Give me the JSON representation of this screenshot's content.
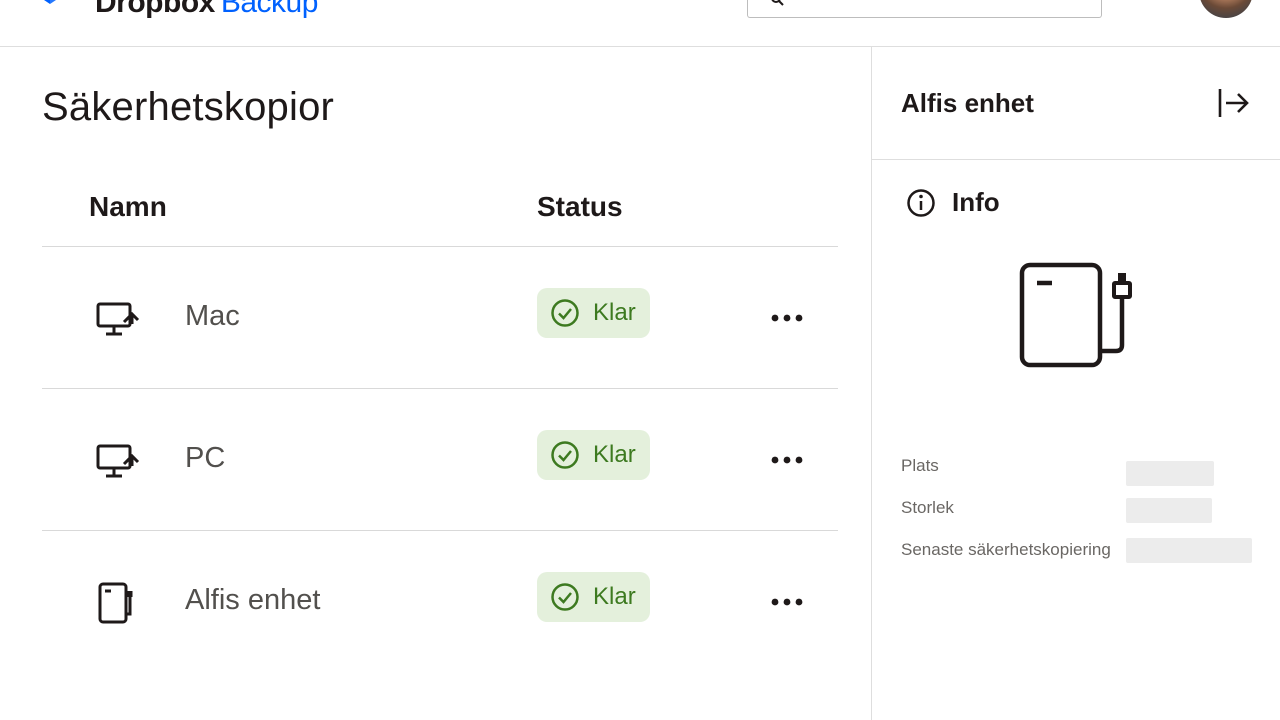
{
  "header": {
    "brand_main": "Dropbox",
    "brand_sub": "Backup"
  },
  "main": {
    "title": "Säkerhetskopior",
    "columns": {
      "name": "Namn",
      "status": "Status"
    },
    "rows": [
      {
        "name": "Mac",
        "status": "Klar",
        "icon": "computer-backup-icon"
      },
      {
        "name": "PC",
        "status": "Klar",
        "icon": "computer-backup-icon"
      },
      {
        "name": "Alfis enhet",
        "status": "Klar",
        "icon": "external-drive-icon"
      }
    ]
  },
  "panel": {
    "title": "Alfis enhet",
    "info_label": "Info",
    "details": [
      {
        "label": "Plats",
        "value": ""
      },
      {
        "label": "Storlek",
        "value": ""
      },
      {
        "label": "Senaste säkerhetskopiering",
        "value": ""
      }
    ]
  },
  "colors": {
    "accent": "#0061fe",
    "status_bg": "#e4f0dc",
    "status_text": "#3d7a20",
    "placeholder": "#ececec"
  }
}
